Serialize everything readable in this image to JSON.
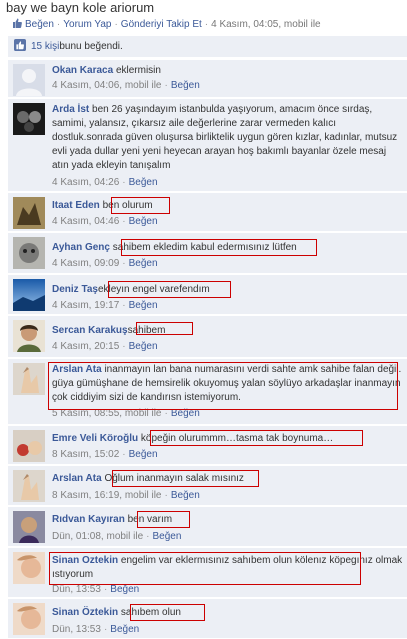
{
  "post": {
    "title": "bay we bayn kole ariorum",
    "actions": {
      "like": "Beğen",
      "comment": "Yorum Yap",
      "follow": "Gönderiyi Takip Et",
      "timestamp": "4 Kasım, 04:05, mobil ile"
    }
  },
  "likes": {
    "count": "15 kişi",
    "suffix": " bunu beğendi."
  },
  "like_label": "Beğen",
  "comments": [
    {
      "author": "Okan Karaca",
      "text": "eklermisin",
      "time": "4 Kasım, 04:06, mobil ile"
    },
    {
      "author": "Arda İst",
      "text": "ben 26 yaşındayım istanbulda yaşıyorum, amacım önce sırdaş, samimi, yalansız, çıkarsız aile değerlerine zarar vermeden kalıcı dostluk.sonrada güven oluşursa birliktelik uygun gören kızlar, kadınlar, mutsuz evli yada dullar yeni yeni heyecan arayan hoş bakımlı bayanlar özele mesaj atın yada ekleyin tanışalım",
      "time": "4 Kasım, 04:26"
    },
    {
      "author": "Itaat Eden",
      "text": "ben olurum",
      "time": "4 Kasım, 04:46"
    },
    {
      "author": "Ayhan Genç",
      "text": "sahibem ekledim kabul edermısınız lütfen",
      "time": "4 Kasım, 09:09"
    },
    {
      "author": "Deniz Taş",
      "text": "ekleyın engel varefendım",
      "time": "4 Kasım, 19:17"
    },
    {
      "author": "Sercan Karakuş",
      "text": "sahibem",
      "time": "4 Kasım, 20:15"
    },
    {
      "author": "Arslan Ata",
      "text": "inanmayın lan bana numarasını verdi sahte amk sahibe falan değil. güya gümüşhane de hemsirelik okuyomuş yalan söylüyo arkadaşlar inanmayın çok ciddiyim sizi de kandırısn istemiyorum.",
      "time": "5 Kasım, 08:55, mobil ile"
    },
    {
      "author": "Emre Veli Köroğlu",
      "text": "köpeğin olurummm…tasma tak boynuma…",
      "time": "8 Kasım, 15:02"
    },
    {
      "author": "Arslan Ata",
      "text": "Oğlum inanmayın salak mısınız",
      "time": "8 Kasım, 16:19, mobil ile"
    },
    {
      "author": "Rıdvan Kayıran",
      "text": "ben varım",
      "time": "Dün, 01:08, mobil ile"
    },
    {
      "author": "Sinan Oztekin",
      "text": "engelim var eklermısınız sahıbem olun kölenız köpegınız olmak ıstıyorum",
      "time": "Dün, 13:53"
    },
    {
      "author": "Sinan Öztekin",
      "text": "sahıbem olun",
      "time": "Dün, 13:53"
    }
  ]
}
